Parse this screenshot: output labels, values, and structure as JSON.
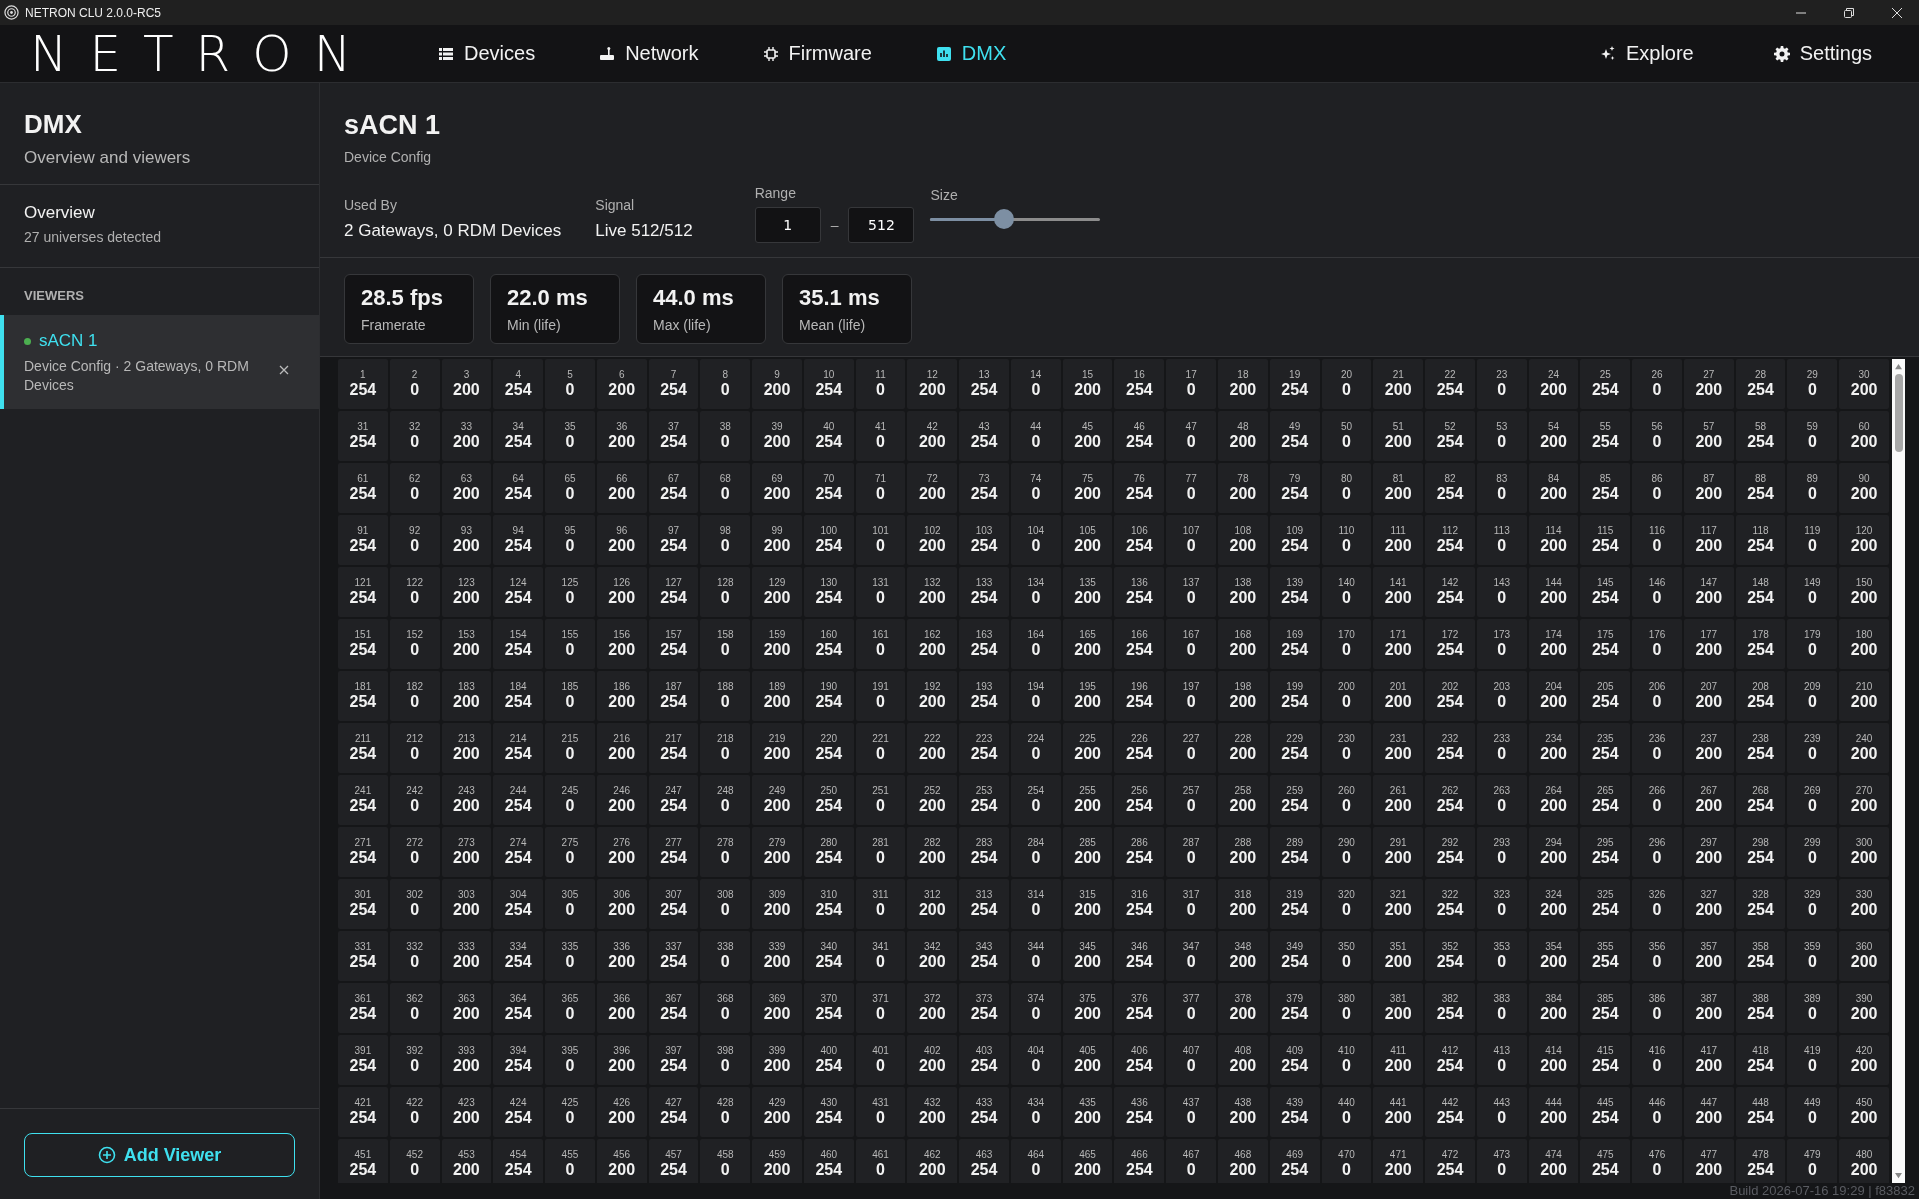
{
  "window": {
    "title": "NETRON CLU 2.0.0-RC5"
  },
  "brand": {
    "logo": "NETRON"
  },
  "nav": [
    {
      "label": "Devices",
      "selected": false
    },
    {
      "label": "Network",
      "selected": false
    },
    {
      "label": "Firmware",
      "selected": false
    },
    {
      "label": "DMX",
      "selected": true
    }
  ],
  "nav_right": [
    {
      "label": "Explore"
    },
    {
      "label": "Settings"
    }
  ],
  "sidebar": {
    "title": "DMX",
    "subtitle": "Overview and viewers",
    "overview": {
      "label": "Overview",
      "detail": "27 universes detected",
      "selected": false
    },
    "section": "VIEWERS",
    "viewers": [
      {
        "name": "sACN 1",
        "detail": "Device Config · 2 Gateways, 0 RDM Devices",
        "color": "#4caf50",
        "selected": true
      }
    ],
    "add_button": "Add Viewer"
  },
  "viewer": {
    "title": "sACN 1",
    "subtitle": "Device Config",
    "used_by": {
      "label": "Used By",
      "value": "2 Gateways, 0 RDM Devices"
    },
    "signal": {
      "label": "Signal",
      "value": "Live 512/512"
    },
    "range": {
      "label": "Range",
      "from": "1",
      "separator": "–",
      "to": "512"
    },
    "size": {
      "label": "Size",
      "level": 0.43
    },
    "stats": [
      {
        "value": "28.5 fps",
        "label": "Framerate"
      },
      {
        "value": "22.0 ms",
        "label": "Min (life)"
      },
      {
        "value": "44.0 ms",
        "label": "Max (life)"
      },
      {
        "value": "35.1 ms",
        "label": "Mean (life)"
      }
    ],
    "channel_rows": [
      [
        {
          "ch": "1",
          "val": "254"
        },
        {
          "ch": "2",
          "val": "0"
        },
        {
          "ch": "3",
          "val": "200"
        },
        {
          "ch": "4",
          "val": "254"
        },
        {
          "ch": "5",
          "val": "0"
        },
        {
          "ch": "6",
          "val": "200"
        },
        {
          "ch": "7",
          "val": "254"
        },
        {
          "ch": "8",
          "val": "0"
        },
        {
          "ch": "9",
          "val": "200"
        },
        {
          "ch": "10",
          "val": "254"
        },
        {
          "ch": "11",
          "val": "0"
        },
        {
          "ch": "12",
          "val": "200"
        },
        {
          "ch": "13",
          "val": "254"
        },
        {
          "ch": "14",
          "val": "0"
        },
        {
          "ch": "15",
          "val": "200"
        },
        {
          "ch": "16",
          "val": "254"
        },
        {
          "ch": "17",
          "val": "0"
        },
        {
          "ch": "18",
          "val": "200"
        },
        {
          "ch": "19",
          "val": "254"
        },
        {
          "ch": "20",
          "val": "0"
        },
        {
          "ch": "21",
          "val": "200"
        },
        {
          "ch": "22",
          "val": "254"
        },
        {
          "ch": "23",
          "val": "0"
        },
        {
          "ch": "24",
          "val": "200"
        },
        {
          "ch": "25",
          "val": "254"
        },
        {
          "ch": "26",
          "val": "0"
        },
        {
          "ch": "27",
          "val": "200"
        },
        {
          "ch": "28",
          "val": "254"
        },
        {
          "ch": "29",
          "val": "0"
        },
        {
          "ch": "30",
          "val": "200"
        }
      ],
      [
        {
          "ch": "31",
          "val": "254"
        },
        {
          "ch": "32",
          "val": "0"
        },
        {
          "ch": "33",
          "val": "200"
        },
        {
          "ch": "34",
          "val": "254"
        },
        {
          "ch": "35",
          "val": "0"
        },
        {
          "ch": "36",
          "val": "200"
        },
        {
          "ch": "37",
          "val": "254"
        },
        {
          "ch": "38",
          "val": "0"
        },
        {
          "ch": "39",
          "val": "200"
        },
        {
          "ch": "40",
          "val": "254"
        },
        {
          "ch": "41",
          "val": "0"
        },
        {
          "ch": "42",
          "val": "200"
        },
        {
          "ch": "43",
          "val": "254"
        },
        {
          "ch": "44",
          "val": "0"
        },
        {
          "ch": "45",
          "val": "200"
        },
        {
          "ch": "46",
          "val": "254"
        },
        {
          "ch": "47",
          "val": "0"
        },
        {
          "ch": "48",
          "val": "200"
        },
        {
          "ch": "49",
          "val": "254"
        },
        {
          "ch": "50",
          "val": "0"
        },
        {
          "ch": "51",
          "val": "200"
        },
        {
          "ch": "52",
          "val": "254"
        },
        {
          "ch": "53",
          "val": "0"
        },
        {
          "ch": "54",
          "val": "200"
        },
        {
          "ch": "55",
          "val": "254"
        },
        {
          "ch": "56",
          "val": "0"
        },
        {
          "ch": "57",
          "val": "200"
        },
        {
          "ch": "58",
          "val": "254"
        },
        {
          "ch": "59",
          "val": "0"
        },
        {
          "ch": "60",
          "val": "200"
        }
      ],
      [
        {
          "ch": "61",
          "val": "254"
        },
        {
          "ch": "62",
          "val": "0"
        },
        {
          "ch": "63",
          "val": "200"
        },
        {
          "ch": "64",
          "val": "254"
        },
        {
          "ch": "65",
          "val": "0"
        },
        {
          "ch": "66",
          "val": "200"
        },
        {
          "ch": "67",
          "val": "254"
        },
        {
          "ch": "68",
          "val": "0"
        },
        {
          "ch": "69",
          "val": "200"
        },
        {
          "ch": "70",
          "val": "254"
        },
        {
          "ch": "71",
          "val": "0"
        },
        {
          "ch": "72",
          "val": "200"
        },
        {
          "ch": "73",
          "val": "254"
        },
        {
          "ch": "74",
          "val": "0"
        },
        {
          "ch": "75",
          "val": "200"
        },
        {
          "ch": "76",
          "val": "254"
        },
        {
          "ch": "77",
          "val": "0"
        },
        {
          "ch": "78",
          "val": "200"
        },
        {
          "ch": "79",
          "val": "254"
        },
        {
          "ch": "80",
          "val": "0"
        },
        {
          "ch": "81",
          "val": "200"
        },
        {
          "ch": "82",
          "val": "254"
        },
        {
          "ch": "83",
          "val": "0"
        },
        {
          "ch": "84",
          "val": "200"
        },
        {
          "ch": "85",
          "val": "254"
        },
        {
          "ch": "86",
          "val": "0"
        },
        {
          "ch": "87",
          "val": "200"
        },
        {
          "ch": "88",
          "val": "254"
        },
        {
          "ch": "89",
          "val": "0"
        },
        {
          "ch": "90",
          "val": "200"
        }
      ],
      [
        {
          "ch": "91",
          "val": "254"
        },
        {
          "ch": "92",
          "val": "0"
        },
        {
          "ch": "93",
          "val": "200"
        },
        {
          "ch": "94",
          "val": "254"
        },
        {
          "ch": "95",
          "val": "0"
        },
        {
          "ch": "96",
          "val": "200"
        },
        {
          "ch": "97",
          "val": "254"
        },
        {
          "ch": "98",
          "val": "0"
        },
        {
          "ch": "99",
          "val": "200"
        },
        {
          "ch": "100",
          "val": "254"
        },
        {
          "ch": "101",
          "val": "0"
        },
        {
          "ch": "102",
          "val": "200"
        },
        {
          "ch": "103",
          "val": "254"
        },
        {
          "ch": "104",
          "val": "0"
        },
        {
          "ch": "105",
          "val": "200"
        },
        {
          "ch": "106",
          "val": "254"
        },
        {
          "ch": "107",
          "val": "0"
        },
        {
          "ch": "108",
          "val": "200"
        },
        {
          "ch": "109",
          "val": "254"
        },
        {
          "ch": "110",
          "val": "0"
        },
        {
          "ch": "111",
          "val": "200"
        },
        {
          "ch": "112",
          "val": "254"
        },
        {
          "ch": "113",
          "val": "0"
        },
        {
          "ch": "114",
          "val": "200"
        },
        {
          "ch": "115",
          "val": "254"
        },
        {
          "ch": "116",
          "val": "0"
        },
        {
          "ch": "117",
          "val": "200"
        },
        {
          "ch": "118",
          "val": "254"
        },
        {
          "ch": "119",
          "val": "0"
        },
        {
          "ch": "120",
          "val": "200"
        }
      ],
      [
        {
          "ch": "121",
          "val": "254"
        },
        {
          "ch": "122",
          "val": "0"
        },
        {
          "ch": "123",
          "val": "200"
        },
        {
          "ch": "124",
          "val": "254"
        },
        {
          "ch": "125",
          "val": "0"
        },
        {
          "ch": "126",
          "val": "200"
        },
        {
          "ch": "127",
          "val": "254"
        },
        {
          "ch": "128",
          "val": "0"
        },
        {
          "ch": "129",
          "val": "200"
        },
        {
          "ch": "130",
          "val": "254"
        },
        {
          "ch": "131",
          "val": "0"
        },
        {
          "ch": "132",
          "val": "200"
        },
        {
          "ch": "133",
          "val": "254"
        },
        {
          "ch": "134",
          "val": "0"
        },
        {
          "ch": "135",
          "val": "200"
        },
        {
          "ch": "136",
          "val": "254"
        },
        {
          "ch": "137",
          "val": "0"
        },
        {
          "ch": "138",
          "val": "200"
        },
        {
          "ch": "139",
          "val": "254"
        },
        {
          "ch": "140",
          "val": "0"
        },
        {
          "ch": "141",
          "val": "200"
        },
        {
          "ch": "142",
          "val": "254"
        },
        {
          "ch": "143",
          "val": "0"
        },
        {
          "ch": "144",
          "val": "200"
        },
        {
          "ch": "145",
          "val": "254"
        },
        {
          "ch": "146",
          "val": "0"
        },
        {
          "ch": "147",
          "val": "200"
        },
        {
          "ch": "148",
          "val": "254"
        },
        {
          "ch": "149",
          "val": "0"
        },
        {
          "ch": "150",
          "val": "200"
        }
      ],
      [
        {
          "ch": "151",
          "val": "254"
        },
        {
          "ch": "152",
          "val": "0"
        },
        {
          "ch": "153",
          "val": "200"
        },
        {
          "ch": "154",
          "val": "254"
        },
        {
          "ch": "155",
          "val": "0"
        },
        {
          "ch": "156",
          "val": "200"
        },
        {
          "ch": "157",
          "val": "254"
        },
        {
          "ch": "158",
          "val": "0"
        },
        {
          "ch": "159",
          "val": "200"
        },
        {
          "ch": "160",
          "val": "254"
        },
        {
          "ch": "161",
          "val": "0"
        },
        {
          "ch": "162",
          "val": "200"
        },
        {
          "ch": "163",
          "val": "254"
        },
        {
          "ch": "164",
          "val": "0"
        },
        {
          "ch": "165",
          "val": "200"
        },
        {
          "ch": "166",
          "val": "254"
        },
        {
          "ch": "167",
          "val": "0"
        },
        {
          "ch": "168",
          "val": "200"
        },
        {
          "ch": "169",
          "val": "254"
        },
        {
          "ch": "170",
          "val": "0"
        },
        {
          "ch": "171",
          "val": "200"
        },
        {
          "ch": "172",
          "val": "254"
        },
        {
          "ch": "173",
          "val": "0"
        },
        {
          "ch": "174",
          "val": "200"
        },
        {
          "ch": "175",
          "val": "254"
        },
        {
          "ch": "176",
          "val": "0"
        },
        {
          "ch": "177",
          "val": "200"
        },
        {
          "ch": "178",
          "val": "254"
        },
        {
          "ch": "179",
          "val": "0"
        },
        {
          "ch": "180",
          "val": "200"
        }
      ],
      [
        {
          "ch": "181",
          "val": "254"
        },
        {
          "ch": "182",
          "val": "0"
        },
        {
          "ch": "183",
          "val": "200"
        },
        {
          "ch": "184",
          "val": "254"
        },
        {
          "ch": "185",
          "val": "0"
        },
        {
          "ch": "186",
          "val": "200"
        },
        {
          "ch": "187",
          "val": "254"
        },
        {
          "ch": "188",
          "val": "0"
        },
        {
          "ch": "189",
          "val": "200"
        },
        {
          "ch": "190",
          "val": "254"
        },
        {
          "ch": "191",
          "val": "0"
        },
        {
          "ch": "192",
          "val": "200"
        },
        {
          "ch": "193",
          "val": "254"
        },
        {
          "ch": "194",
          "val": "0"
        },
        {
          "ch": "195",
          "val": "200"
        },
        {
          "ch": "196",
          "val": "254"
        },
        {
          "ch": "197",
          "val": "0"
        },
        {
          "ch": "198",
          "val": "200"
        },
        {
          "ch": "199",
          "val": "254"
        },
        {
          "ch": "200",
          "val": "0"
        },
        {
          "ch": "201",
          "val": "200"
        },
        {
          "ch": "202",
          "val": "254"
        },
        {
          "ch": "203",
          "val": "0"
        },
        {
          "ch": "204",
          "val": "200"
        },
        {
          "ch": "205",
          "val": "254"
        },
        {
          "ch": "206",
          "val": "0"
        },
        {
          "ch": "207",
          "val": "200"
        },
        {
          "ch": "208",
          "val": "254"
        },
        {
          "ch": "209",
          "val": "0"
        },
        {
          "ch": "210",
          "val": "200"
        }
      ],
      [
        {
          "ch": "211",
          "val": "254"
        },
        {
          "ch": "212",
          "val": "0"
        },
        {
          "ch": "213",
          "val": "200"
        },
        {
          "ch": "214",
          "val": "254"
        },
        {
          "ch": "215",
          "val": "0"
        },
        {
          "ch": "216",
          "val": "200"
        },
        {
          "ch": "217",
          "val": "254"
        },
        {
          "ch": "218",
          "val": "0"
        },
        {
          "ch": "219",
          "val": "200"
        },
        {
          "ch": "220",
          "val": "254"
        },
        {
          "ch": "221",
          "val": "0"
        },
        {
          "ch": "222",
          "val": "200"
        },
        {
          "ch": "223",
          "val": "254"
        },
        {
          "ch": "224",
          "val": "0"
        },
        {
          "ch": "225",
          "val": "200"
        },
        {
          "ch": "226",
          "val": "254"
        },
        {
          "ch": "227",
          "val": "0"
        },
        {
          "ch": "228",
          "val": "200"
        },
        {
          "ch": "229",
          "val": "254"
        },
        {
          "ch": "230",
          "val": "0"
        },
        {
          "ch": "231",
          "val": "200"
        },
        {
          "ch": "232",
          "val": "254"
        },
        {
          "ch": "233",
          "val": "0"
        },
        {
          "ch": "234",
          "val": "200"
        },
        {
          "ch": "235",
          "val": "254"
        },
        {
          "ch": "236",
          "val": "0"
        },
        {
          "ch": "237",
          "val": "200"
        },
        {
          "ch": "238",
          "val": "254"
        },
        {
          "ch": "239",
          "val": "0"
        },
        {
          "ch": "240",
          "val": "200"
        }
      ],
      [
        {
          "ch": "241",
          "val": "254"
        },
        {
          "ch": "242",
          "val": "0"
        },
        {
          "ch": "243",
          "val": "200"
        },
        {
          "ch": "244",
          "val": "254"
        },
        {
          "ch": "245",
          "val": "0"
        },
        {
          "ch": "246",
          "val": "200"
        },
        {
          "ch": "247",
          "val": "254"
        },
        {
          "ch": "248",
          "val": "0"
        },
        {
          "ch": "249",
          "val": "200"
        },
        {
          "ch": "250",
          "val": "254"
        },
        {
          "ch": "251",
          "val": "0"
        },
        {
          "ch": "252",
          "val": "200"
        },
        {
          "ch": "253",
          "val": "254"
        },
        {
          "ch": "254",
          "val": "0"
        },
        {
          "ch": "255",
          "val": "200"
        },
        {
          "ch": "256",
          "val": "254"
        },
        {
          "ch": "257",
          "val": "0"
        },
        {
          "ch": "258",
          "val": "200"
        },
        {
          "ch": "259",
          "val": "254"
        },
        {
          "ch": "260",
          "val": "0"
        },
        {
          "ch": "261",
          "val": "200"
        },
        {
          "ch": "262",
          "val": "254"
        },
        {
          "ch": "263",
          "val": "0"
        },
        {
          "ch": "264",
          "val": "200"
        },
        {
          "ch": "265",
          "val": "254"
        },
        {
          "ch": "266",
          "val": "0"
        },
        {
          "ch": "267",
          "val": "200"
        },
        {
          "ch": "268",
          "val": "254"
        },
        {
          "ch": "269",
          "val": "0"
        },
        {
          "ch": "270",
          "val": "200"
        }
      ],
      [
        {
          "ch": "271",
          "val": "254"
        },
        {
          "ch": "272",
          "val": "0"
        },
        {
          "ch": "273",
          "val": "200"
        },
        {
          "ch": "274",
          "val": "254"
        },
        {
          "ch": "275",
          "val": "0"
        },
        {
          "ch": "276",
          "val": "200"
        },
        {
          "ch": "277",
          "val": "254"
        },
        {
          "ch": "278",
          "val": "0"
        },
        {
          "ch": "279",
          "val": "200"
        },
        {
          "ch": "280",
          "val": "254"
        },
        {
          "ch": "281",
          "val": "0"
        },
        {
          "ch": "282",
          "val": "200"
        },
        {
          "ch": "283",
          "val": "254"
        },
        {
          "ch": "284",
          "val": "0"
        },
        {
          "ch": "285",
          "val": "200"
        },
        {
          "ch": "286",
          "val": "254"
        },
        {
          "ch": "287",
          "val": "0"
        },
        {
          "ch": "288",
          "val": "200"
        },
        {
          "ch": "289",
          "val": "254"
        },
        {
          "ch": "290",
          "val": "0"
        },
        {
          "ch": "291",
          "val": "200"
        },
        {
          "ch": "292",
          "val": "254"
        },
        {
          "ch": "293",
          "val": "0"
        },
        {
          "ch": "294",
          "val": "200"
        },
        {
          "ch": "295",
          "val": "254"
        },
        {
          "ch": "296",
          "val": "0"
        },
        {
          "ch": "297",
          "val": "200"
        },
        {
          "ch": "298",
          "val": "254"
        },
        {
          "ch": "299",
          "val": "0"
        },
        {
          "ch": "300",
          "val": "200"
        }
      ],
      [
        {
          "ch": "301",
          "val": "254"
        },
        {
          "ch": "302",
          "val": "0"
        },
        {
          "ch": "303",
          "val": "200"
        },
        {
          "ch": "304",
          "val": "254"
        },
        {
          "ch": "305",
          "val": "0"
        },
        {
          "ch": "306",
          "val": "200"
        },
        {
          "ch": "307",
          "val": "254"
        },
        {
          "ch": "308",
          "val": "0"
        },
        {
          "ch": "309",
          "val": "200"
        },
        {
          "ch": "310",
          "val": "254"
        },
        {
          "ch": "311",
          "val": "0"
        },
        {
          "ch": "312",
          "val": "200"
        },
        {
          "ch": "313",
          "val": "254"
        },
        {
          "ch": "314",
          "val": "0"
        },
        {
          "ch": "315",
          "val": "200"
        },
        {
          "ch": "316",
          "val": "254"
        },
        {
          "ch": "317",
          "val": "0"
        },
        {
          "ch": "318",
          "val": "200"
        },
        {
          "ch": "319",
          "val": "254"
        },
        {
          "ch": "320",
          "val": "0"
        },
        {
          "ch": "321",
          "val": "200"
        },
        {
          "ch": "322",
          "val": "254"
        },
        {
          "ch": "323",
          "val": "0"
        },
        {
          "ch": "324",
          "val": "200"
        },
        {
          "ch": "325",
          "val": "254"
        },
        {
          "ch": "326",
          "val": "0"
        },
        {
          "ch": "327",
          "val": "200"
        },
        {
          "ch": "328",
          "val": "254"
        },
        {
          "ch": "329",
          "val": "0"
        },
        {
          "ch": "330",
          "val": "200"
        }
      ],
      [
        {
          "ch": "331",
          "val": "254"
        },
        {
          "ch": "332",
          "val": "0"
        },
        {
          "ch": "333",
          "val": "200"
        },
        {
          "ch": "334",
          "val": "254"
        },
        {
          "ch": "335",
          "val": "0"
        },
        {
          "ch": "336",
          "val": "200"
        },
        {
          "ch": "337",
          "val": "254"
        },
        {
          "ch": "338",
          "val": "0"
        },
        {
          "ch": "339",
          "val": "200"
        },
        {
          "ch": "340",
          "val": "254"
        },
        {
          "ch": "341",
          "val": "0"
        },
        {
          "ch": "342",
          "val": "200"
        },
        {
          "ch": "343",
          "val": "254"
        },
        {
          "ch": "344",
          "val": "0"
        },
        {
          "ch": "345",
          "val": "200"
        },
        {
          "ch": "346",
          "val": "254"
        },
        {
          "ch": "347",
          "val": "0"
        },
        {
          "ch": "348",
          "val": "200"
        },
        {
          "ch": "349",
          "val": "254"
        },
        {
          "ch": "350",
          "val": "0"
        },
        {
          "ch": "351",
          "val": "200"
        },
        {
          "ch": "352",
          "val": "254"
        },
        {
          "ch": "353",
          "val": "0"
        },
        {
          "ch": "354",
          "val": "200"
        },
        {
          "ch": "355",
          "val": "254"
        },
        {
          "ch": "356",
          "val": "0"
        },
        {
          "ch": "357",
          "val": "200"
        },
        {
          "ch": "358",
          "val": "254"
        },
        {
          "ch": "359",
          "val": "0"
        },
        {
          "ch": "360",
          "val": "200"
        }
      ],
      [
        {
          "ch": "361",
          "val": "254"
        },
        {
          "ch": "362",
          "val": "0"
        },
        {
          "ch": "363",
          "val": "200"
        },
        {
          "ch": "364",
          "val": "254"
        },
        {
          "ch": "365",
          "val": "0"
        },
        {
          "ch": "366",
          "val": "200"
        },
        {
          "ch": "367",
          "val": "254"
        },
        {
          "ch": "368",
          "val": "0"
        },
        {
          "ch": "369",
          "val": "200"
        },
        {
          "ch": "370",
          "val": "254"
        },
        {
          "ch": "371",
          "val": "0"
        },
        {
          "ch": "372",
          "val": "200"
        },
        {
          "ch": "373",
          "val": "254"
        },
        {
          "ch": "374",
          "val": "0"
        },
        {
          "ch": "375",
          "val": "200"
        },
        {
          "ch": "376",
          "val": "254"
        },
        {
          "ch": "377",
          "val": "0"
        },
        {
          "ch": "378",
          "val": "200"
        },
        {
          "ch": "379",
          "val": "254"
        },
        {
          "ch": "380",
          "val": "0"
        },
        {
          "ch": "381",
          "val": "200"
        },
        {
          "ch": "382",
          "val": "254"
        },
        {
          "ch": "383",
          "val": "0"
        },
        {
          "ch": "384",
          "val": "200"
        },
        {
          "ch": "385",
          "val": "254"
        },
        {
          "ch": "386",
          "val": "0"
        },
        {
          "ch": "387",
          "val": "200"
        },
        {
          "ch": "388",
          "val": "254"
        },
        {
          "ch": "389",
          "val": "0"
        },
        {
          "ch": "390",
          "val": "200"
        }
      ],
      [
        {
          "ch": "391",
          "val": "254"
        },
        {
          "ch": "392",
          "val": "0"
        },
        {
          "ch": "393",
          "val": "200"
        },
        {
          "ch": "394",
          "val": "254"
        },
        {
          "ch": "395",
          "val": "0"
        },
        {
          "ch": "396",
          "val": "200"
        },
        {
          "ch": "397",
          "val": "254"
        },
        {
          "ch": "398",
          "val": "0"
        },
        {
          "ch": "399",
          "val": "200"
        },
        {
          "ch": "400",
          "val": "254"
        },
        {
          "ch": "401",
          "val": "0"
        },
        {
          "ch": "402",
          "val": "200"
        },
        {
          "ch": "403",
          "val": "254"
        },
        {
          "ch": "404",
          "val": "0"
        },
        {
          "ch": "405",
          "val": "200"
        },
        {
          "ch": "406",
          "val": "254"
        },
        {
          "ch": "407",
          "val": "0"
        },
        {
          "ch": "408",
          "val": "200"
        },
        {
          "ch": "409",
          "val": "254"
        },
        {
          "ch": "410",
          "val": "0"
        },
        {
          "ch": "411",
          "val": "200"
        },
        {
          "ch": "412",
          "val": "254"
        },
        {
          "ch": "413",
          "val": "0"
        },
        {
          "ch": "414",
          "val": "200"
        },
        {
          "ch": "415",
          "val": "254"
        },
        {
          "ch": "416",
          "val": "0"
        },
        {
          "ch": "417",
          "val": "200"
        },
        {
          "ch": "418",
          "val": "254"
        },
        {
          "ch": "419",
          "val": "0"
        },
        {
          "ch": "420",
          "val": "200"
        }
      ],
      [
        {
          "ch": "421",
          "val": "254"
        },
        {
          "ch": "422",
          "val": "0"
        },
        {
          "ch": "423",
          "val": "200"
        },
        {
          "ch": "424",
          "val": "254"
        },
        {
          "ch": "425",
          "val": "0"
        },
        {
          "ch": "426",
          "val": "200"
        },
        {
          "ch": "427",
          "val": "254"
        },
        {
          "ch": "428",
          "val": "0"
        },
        {
          "ch": "429",
          "val": "200"
        },
        {
          "ch": "430",
          "val": "254"
        },
        {
          "ch": "431",
          "val": "0"
        },
        {
          "ch": "432",
          "val": "200"
        },
        {
          "ch": "433",
          "val": "254"
        },
        {
          "ch": "434",
          "val": "0"
        },
        {
          "ch": "435",
          "val": "200"
        },
        {
          "ch": "436",
          "val": "254"
        },
        {
          "ch": "437",
          "val": "0"
        },
        {
          "ch": "438",
          "val": "200"
        },
        {
          "ch": "439",
          "val": "254"
        },
        {
          "ch": "440",
          "val": "0"
        },
        {
          "ch": "441",
          "val": "200"
        },
        {
          "ch": "442",
          "val": "254"
        },
        {
          "ch": "443",
          "val": "0"
        },
        {
          "ch": "444",
          "val": "200"
        },
        {
          "ch": "445",
          "val": "254"
        },
        {
          "ch": "446",
          "val": "0"
        },
        {
          "ch": "447",
          "val": "200"
        },
        {
          "ch": "448",
          "val": "254"
        },
        {
          "ch": "449",
          "val": "0"
        },
        {
          "ch": "450",
          "val": "200"
        }
      ],
      [
        {
          "ch": "451",
          "val": "254"
        },
        {
          "ch": "452",
          "val": "0"
        },
        {
          "ch": "453",
          "val": "200"
        },
        {
          "ch": "454",
          "val": "254"
        },
        {
          "ch": "455",
          "val": "0"
        },
        {
          "ch": "456",
          "val": "200"
        },
        {
          "ch": "457",
          "val": "254"
        },
        {
          "ch": "458",
          "val": "0"
        },
        {
          "ch": "459",
          "val": "200"
        },
        {
          "ch": "460",
          "val": "254"
        },
        {
          "ch": "461",
          "val": "0"
        },
        {
          "ch": "462",
          "val": "200"
        },
        {
          "ch": "463",
          "val": "254"
        },
        {
          "ch": "464",
          "val": "0"
        },
        {
          "ch": "465",
          "val": "200"
        },
        {
          "ch": "466",
          "val": "254"
        },
        {
          "ch": "467",
          "val": "0"
        },
        {
          "ch": "468",
          "val": "200"
        },
        {
          "ch": "469",
          "val": "254"
        },
        {
          "ch": "470",
          "val": "0"
        },
        {
          "ch": "471",
          "val": "200"
        },
        {
          "ch": "472",
          "val": "254"
        },
        {
          "ch": "473",
          "val": "0"
        },
        {
          "ch": "474",
          "val": "200"
        },
        {
          "ch": "475",
          "val": "254"
        },
        {
          "ch": "476",
          "val": "0"
        },
        {
          "ch": "477",
          "val": "200"
        },
        {
          "ch": "478",
          "val": "254"
        },
        {
          "ch": "479",
          "val": "0"
        },
        {
          "ch": "480",
          "val": "200"
        }
      ]
    ]
  },
  "status_bar": {
    "build": "Build 2026-07-16 19:29 | f83832"
  }
}
